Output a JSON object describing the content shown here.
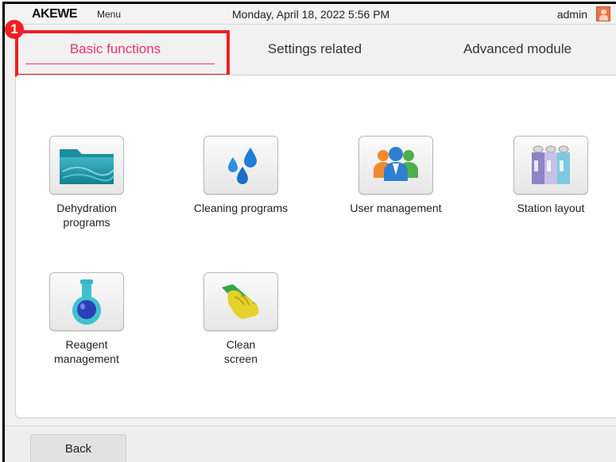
{
  "topbar": {
    "brand": "AKEWE",
    "menu_label": "Menu",
    "datetime": "Monday, April 18, 2022 5:56 PM",
    "user_name": "admin"
  },
  "tabs": [
    {
      "label": "Basic functions",
      "active": true
    },
    {
      "label": "Settings related",
      "active": false
    },
    {
      "label": "Advanced module",
      "active": false
    }
  ],
  "annotation": {
    "step": "1",
    "color": "#ef1f24"
  },
  "functions": [
    {
      "label": "Dehydration\nprograms",
      "icon": "folder-icon"
    },
    {
      "label": "Cleaning programs",
      "icon": "water-drops-icon"
    },
    {
      "label": "User management",
      "icon": "users-icon"
    },
    {
      "label": "Station layout",
      "icon": "station-layout-icon"
    },
    {
      "label": "Reagent\nmanagement",
      "icon": "flask-icon"
    },
    {
      "label": "Clean\nscreen",
      "icon": "glove-cleaning-icon"
    }
  ],
  "bottombar": {
    "back_label": "Back"
  },
  "colors": {
    "accent": "#e8336f",
    "annotation": "#ef1f24"
  }
}
